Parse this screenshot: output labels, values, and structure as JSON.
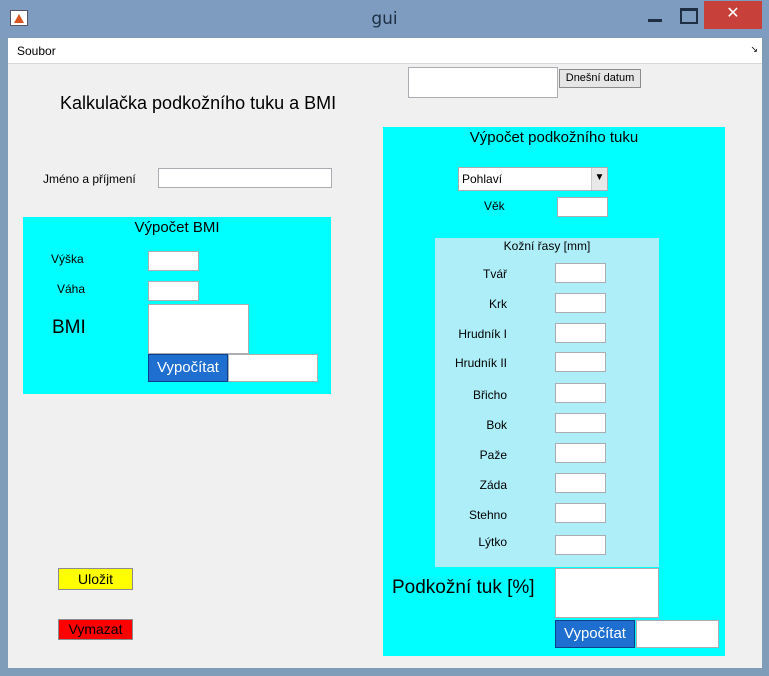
{
  "window": {
    "title": "gui"
  },
  "menu": {
    "file": "Soubor",
    "arrow": "↘"
  },
  "header": {
    "title": "Kalkulačka podkožního tuku a BMI",
    "date_button": "Dnešní datum",
    "date_value": ""
  },
  "person": {
    "name_label": "Jméno a příjmení",
    "name_value": ""
  },
  "bmi": {
    "title": "Výpočet BMI",
    "height_label": "Výška",
    "weight_label": "Váha",
    "bmi_label": "BMI",
    "compute_button": "Vypočítat"
  },
  "fat": {
    "title": "Výpočet podkožního tuku",
    "sex_select": "Pohlaví",
    "age_label": "Věk",
    "folds_title": "Kožní řasy [mm]",
    "folds": [
      "Tvář",
      "Krk",
      "Hrudník I",
      "Hrudník II",
      "Břicho",
      "Bok",
      "Paže",
      "Záda",
      "Stehno",
      "Lýtko"
    ],
    "result_label": "Podkožní tuk [%]",
    "compute_button": "Vypočítat"
  },
  "actions": {
    "save": "Uložit",
    "clear": "Vymazat"
  },
  "colors": {
    "panel": "#00ffff",
    "folds_panel": "#aeeef8",
    "compute": "#1e6fd0",
    "save": "#ffff00",
    "clear": "#ff0000"
  }
}
